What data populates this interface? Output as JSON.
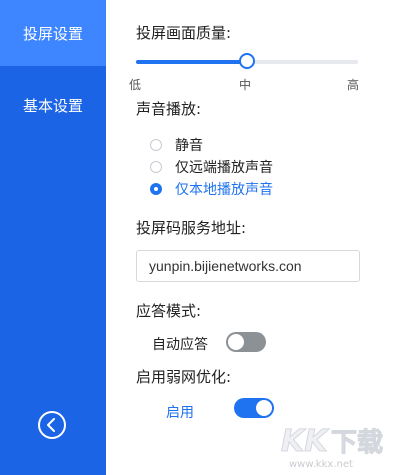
{
  "sidebar": {
    "items": [
      {
        "label": "投屏设置",
        "active": true
      },
      {
        "label": "基本设置",
        "active": false
      }
    ],
    "back_icon": "chevron-left-circle-icon"
  },
  "quality": {
    "label": "投屏画面质量:",
    "ticks": [
      "低",
      "中",
      "高"
    ],
    "value_fraction": 0.5
  },
  "sound": {
    "label": "声音播放:",
    "options": [
      {
        "label": "静音",
        "selected": false
      },
      {
        "label": "仅远端播放声音",
        "selected": false
      },
      {
        "label": "仅本地播放声音",
        "selected": true
      }
    ]
  },
  "address": {
    "label": "投屏码服务地址:",
    "value": "yunpin.bijienetworks.con"
  },
  "answer_mode": {
    "label": "应答模式:",
    "toggle_label": "自动应答",
    "enabled": false
  },
  "weak_network": {
    "label": "启用弱网优化:",
    "toggle_label": "启用",
    "enabled": true
  },
  "watermark": {
    "logo_text": "KK下载",
    "url": "www.kkx.net"
  },
  "colors": {
    "sidebar_bg": "#1c64e6",
    "sidebar_active_bg": "#3d86ff",
    "accent": "#1f73f0",
    "toggle_off": "#8c9196"
  }
}
